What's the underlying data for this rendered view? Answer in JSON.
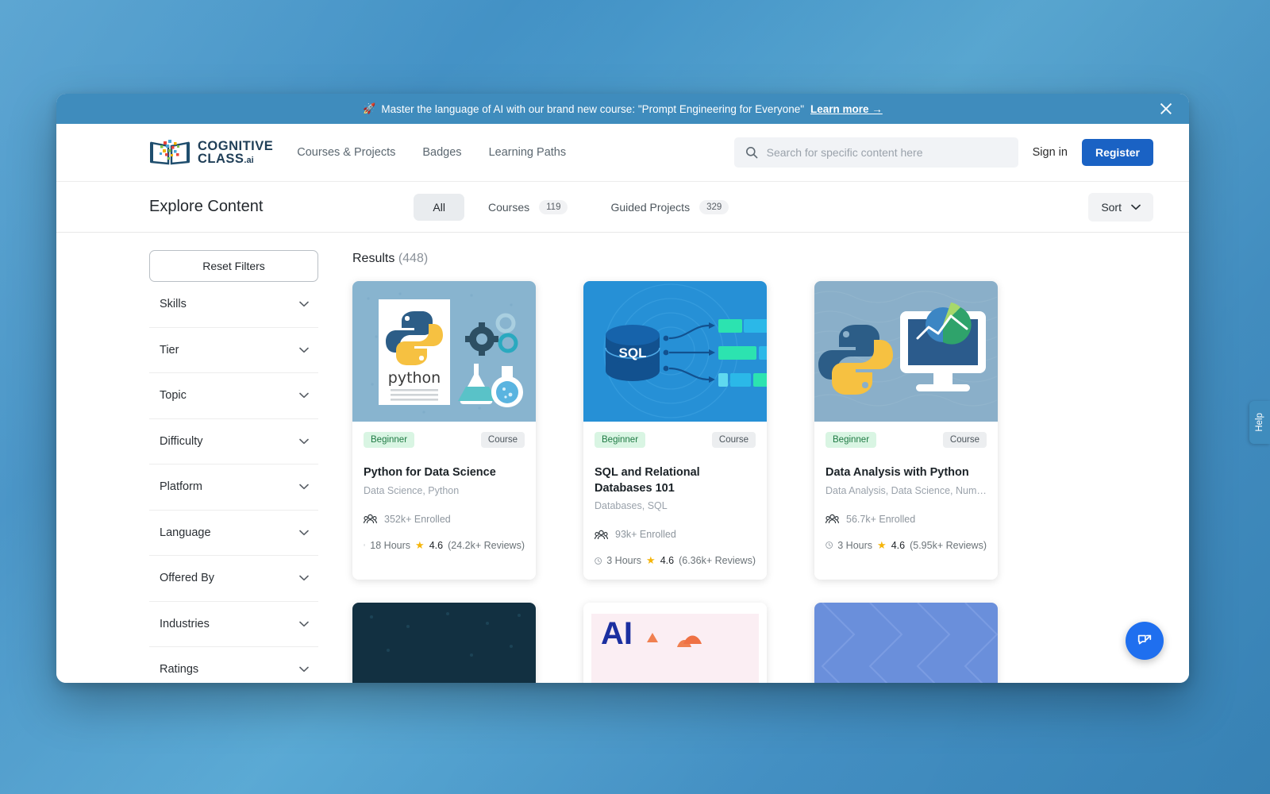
{
  "announcement": {
    "rocket_icon": "rocket-icon",
    "text": "Master the language of AI with our brand new course: \"Prompt Engineering for Everyone\"",
    "link_label": "Learn more →",
    "close_icon": "close-icon"
  },
  "header": {
    "brand": {
      "line1": "COGNITIVE",
      "line2": "CLASS",
      "suffix": ".ai"
    },
    "nav": [
      {
        "label": "Courses & Projects"
      },
      {
        "label": "Badges"
      },
      {
        "label": "Learning Paths"
      }
    ],
    "search": {
      "placeholder": "Search for specific content here",
      "value": "",
      "icon": "search-icon"
    },
    "sign_in_label": "Sign in",
    "register_label": "Register"
  },
  "toolbar": {
    "title": "Explore Content",
    "tabs": [
      {
        "label": "All",
        "count": "",
        "active": true
      },
      {
        "label": "Courses",
        "count": "119",
        "active": false
      },
      {
        "label": "Guided Projects",
        "count": "329",
        "active": false
      }
    ],
    "sort_label": "Sort",
    "sort_icon": "chevron-down-icon"
  },
  "sidebar": {
    "reset_label": "Reset Filters",
    "filters": [
      {
        "label": "Skills"
      },
      {
        "label": "Tier"
      },
      {
        "label": "Topic"
      },
      {
        "label": "Difficulty"
      },
      {
        "label": "Platform"
      },
      {
        "label": "Language"
      },
      {
        "label": "Offered By"
      },
      {
        "label": "Industries"
      },
      {
        "label": "Ratings"
      }
    ]
  },
  "results": {
    "label": "Results",
    "count": "(448)",
    "cards": [
      {
        "thumb": "python-data-science-thumb",
        "level": "Beginner",
        "type": "Course",
        "title": "Python for Data Science",
        "tags": "Data Science, Python",
        "enrolled": "352k+ Enrolled",
        "duration": "18 Hours",
        "rating": "4.6",
        "reviews": "(24.2k+ Reviews)"
      },
      {
        "thumb": "sql-databases-thumb",
        "level": "Beginner",
        "type": "Course",
        "title": "SQL and Relational Databases 101",
        "tags": "Databases, SQL",
        "enrolled": "93k+ Enrolled",
        "duration": "3 Hours",
        "rating": "4.6",
        "reviews": "(6.36k+ Reviews)"
      },
      {
        "thumb": "data-analysis-python-thumb",
        "level": "Beginner",
        "type": "Course",
        "title": "Data Analysis with Python",
        "tags": "Data Analysis, Data Science, Numpy...",
        "enrolled": "56.7k+ Enrolled",
        "duration": "3 Hours",
        "rating": "4.6",
        "reviews": "(5.95k+ Reviews)"
      },
      {
        "thumb": "dark-navy-thumb"
      },
      {
        "thumb": "ai-pink-thumb",
        "thumb_text": "AI"
      },
      {
        "thumb": "periwinkle-thumb"
      }
    ]
  },
  "widgets": {
    "help_label": "Help",
    "chat_icon": "chat-launch-icon"
  },
  "colors": {
    "accent_blue": "#1a62c4",
    "announce_blue": "#3f8cbd",
    "badge_green_bg": "#d9f5e3",
    "badge_green_fg": "#1f7a44",
    "fab_blue": "#1f6fef",
    "star_yellow": "#f5b50a"
  }
}
